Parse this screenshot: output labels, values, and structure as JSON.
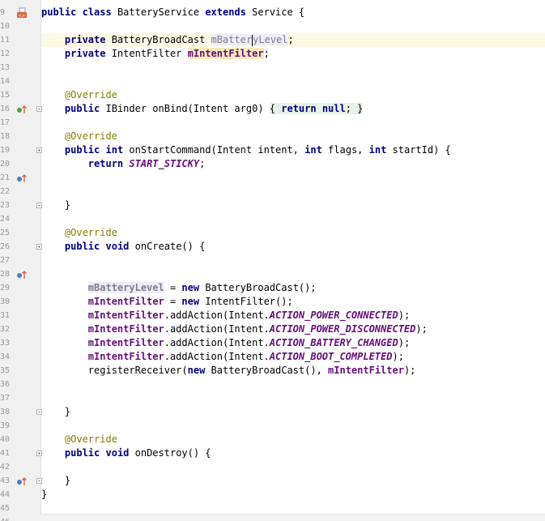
{
  "editor": {
    "accent_colors": {
      "keyword": "#000080",
      "annotation": "#808000",
      "field": "#660e7a",
      "current_line": "#fdf9e5"
    },
    "gutter": {
      "line_numbers": [
        "9",
        "10",
        "11",
        "12",
        "13",
        "14",
        "15",
        "16",
        "17",
        "18",
        "19",
        "20",
        "21",
        "22",
        "23",
        "24",
        "25",
        "26",
        "27",
        "28",
        "29",
        "30",
        "31",
        "32",
        "33",
        "34",
        "35",
        "36",
        "37",
        "38",
        "39",
        "40",
        "41",
        "42",
        "43",
        "44",
        "45",
        "46",
        "47"
      ],
      "icons": [
        {
          "line": "9",
          "name": "class-file-icon"
        },
        {
          "line": "16",
          "name": "override-method-icon"
        },
        {
          "line": "21",
          "name": "override-method-icon"
        },
        {
          "line": "28",
          "name": "override-method-icon"
        },
        {
          "line": "43",
          "name": "override-method-icon"
        }
      ]
    },
    "code": {
      "l9": {
        "public": "public",
        "class": "class",
        "name": " BatteryService ",
        "extends": "extends",
        "rest": " Service {"
      },
      "l11": {
        "indent": "    ",
        "private": "private",
        "type": " BatteryBroadCast ",
        "field_a": "mBatter",
        "field_b": "yLevel",
        "end": ";"
      },
      "l12": {
        "indent": "    ",
        "private": "private",
        "type": " IntentFilter ",
        "field": "mIntentFilter",
        "end": ";"
      },
      "l15": {
        "indent": "    ",
        "annotation": "@Override"
      },
      "l16": {
        "indent": "    ",
        "public": "public",
        "sig": " IBinder onBind(Intent arg0) ",
        "open": "{ ",
        "return": "return",
        "null_sp": " ",
        "null": "null",
        "close": "; }"
      },
      "l18": {
        "indent": "    ",
        "annotation": "@Override"
      },
      "l19": {
        "indent": "    ",
        "public": "public",
        "int": " int",
        "sig_a": " onStartCommand(Intent intent, ",
        "int2": "int",
        "sig_b": " flags, ",
        "int3": "int",
        "sig_c": " startId) {"
      },
      "l20": {
        "indent": "        ",
        "return": "return",
        "sp": " ",
        "const": "START_STICKY",
        "end": ";"
      },
      "l23": {
        "indent": "    ",
        "brace": "}"
      },
      "l25": {
        "indent": "    ",
        "annotation": "@Override"
      },
      "l26": {
        "indent": "    ",
        "public": "public",
        "void": " void",
        "sig": " onCreate() {"
      },
      "l29": {
        "indent": "        ",
        "field": "mBatteryLevel",
        "eq": " = ",
        "new": "new",
        "rest": " BatteryBroadCast();"
      },
      "l30": {
        "indent": "        ",
        "field": "mIntentFilter",
        "eq": " = ",
        "new": "new",
        "rest": " IntentFilter();"
      },
      "l31": {
        "indent": "        ",
        "field": "mIntentFilter",
        "call": ".addAction(Intent.",
        "const": "ACTION_POWER_CONNECTED",
        "end": ");"
      },
      "l32": {
        "indent": "        ",
        "field": "mIntentFilter",
        "call": ".addAction(Intent.",
        "const": "ACTION_POWER_DISCONNECTED",
        "end": ");"
      },
      "l33": {
        "indent": "        ",
        "field": "mIntentFilter",
        "call": ".addAction(Intent.",
        "const": "ACTION_BATTERY_CHANGED",
        "end": ");"
      },
      "l34": {
        "indent": "        ",
        "field": "mIntentFilter",
        "call": ".addAction(Intent.",
        "const": "ACTION_BOOT_COMPLETED",
        "end": ");"
      },
      "l35": {
        "indent": "        ",
        "call": "registerReceiver(",
        "new": "new",
        "mid": " BatteryBroadCast(), ",
        "field": "mIntentFilter",
        "end": ");"
      },
      "l38": {
        "indent": "    ",
        "brace": "}"
      },
      "l40": {
        "indent": "    ",
        "annotation": "@Override"
      },
      "l41": {
        "indent": "    ",
        "public": "public",
        "void": " void",
        "sig": " onDestroy() {"
      },
      "l43": {
        "indent": "    ",
        "brace": "}"
      },
      "l44": {
        "brace": "}"
      }
    }
  }
}
